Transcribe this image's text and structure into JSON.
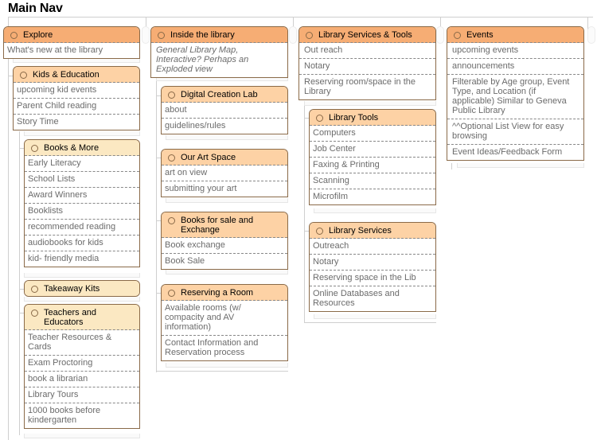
{
  "title": "Main Nav",
  "colors": {
    "level1_header": "#f6ad74",
    "level2_header": "#fdd2a5",
    "level3_header": "#fbe8c2",
    "card_border": "#8a6a48",
    "item_text": "#6b6b6b"
  },
  "columns": [
    {
      "root": {
        "label": "Explore",
        "items": [
          "What's new at the library"
        ]
      },
      "kids": {
        "label": "Kids & Education",
        "items": [
          "upcoming kid events",
          "Parent Child reading",
          "Story Time"
        ]
      },
      "books": {
        "label": "Books & More",
        "items": [
          "Early Literacy",
          "School Lists",
          "Award Winners",
          "Booklists",
          "recommended reading",
          "audiobooks for kids",
          "kid- friendly media"
        ]
      },
      "takeaway": {
        "label": "Takeaway Kits",
        "items": []
      },
      "teachers": {
        "label": "Teachers and Educators",
        "items": [
          "Teacher Resources & Cards",
          "Exam Proctoring",
          "book a librarian",
          "Library Tours",
          "1000 books before kindergarten"
        ]
      }
    },
    {
      "root": {
        "label": "Inside the library",
        "items": [
          "General Library Map, Interactive? Perhaps an Exploded view"
        ]
      },
      "lab": {
        "label": "Digital Creation Lab",
        "items": [
          "about",
          "guidelines/rules"
        ]
      },
      "art": {
        "label": "Our Art Space",
        "items": [
          "art on view",
          "submitting your art"
        ]
      },
      "sale": {
        "label": "Books for sale and Exchange",
        "items": [
          "Book exchange",
          "Book Sale"
        ]
      },
      "room": {
        "label": "Reserving a Room",
        "items": [
          "Available rooms (w/ compacity and AV information)",
          "Contact Information and Reservation process"
        ]
      }
    },
    {
      "root": {
        "label": "Library Services & Tools",
        "items": [
          "Out reach",
          "Notary",
          "Reserving room/space in the Library"
        ]
      },
      "tools": {
        "label": "Library Tools",
        "items": [
          "Computers",
          "Job Center",
          "Faxing & Printing",
          "Scanning",
          "Microfilm"
        ]
      },
      "services": {
        "label": "Library Services",
        "items": [
          "Outreach",
          "Notary",
          "Reserving space in the Lib",
          "Online Databases and Resources"
        ]
      }
    },
    {
      "root": {
        "label": "Events",
        "items": [
          "upcoming events",
          "announcements",
          "Filterable by Age group, Event Type, and Location (if applicable) Similar to Geneva Public Library",
          "^^Optional List View for easy browsing",
          "Event Ideas/Feedback Form"
        ]
      }
    }
  ]
}
